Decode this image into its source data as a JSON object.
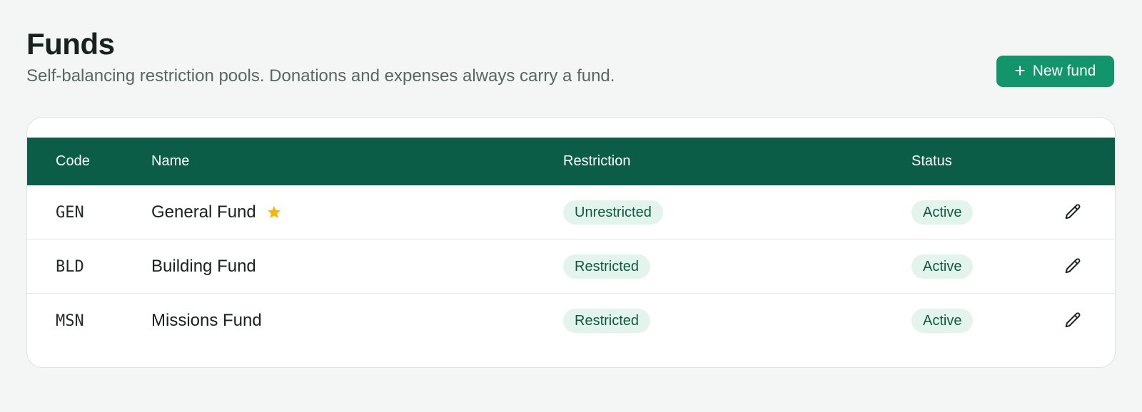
{
  "header": {
    "title": "Funds",
    "subtitle": "Self-balancing restriction pools. Donations and expenses always carry a fund.",
    "new_button_label": "New fund",
    "new_button_icon": "plus-icon"
  },
  "colors": {
    "primary_button": "#12956a",
    "table_header": "#0b5d47",
    "badge_bg": "#e3f4ec",
    "badge_text": "#0d5a43",
    "star": "#f5b50a"
  },
  "table": {
    "columns": [
      "Code",
      "Name",
      "Restriction",
      "Status"
    ],
    "rows": [
      {
        "code": "GEN",
        "name": "General Fund",
        "default": true,
        "default_icon": "star-icon",
        "restriction": "Unrestricted",
        "status": "Active",
        "action_icon": "pencil-icon"
      },
      {
        "code": "BLD",
        "name": "Building Fund",
        "default": false,
        "restriction": "Restricted",
        "status": "Active",
        "action_icon": "pencil-icon"
      },
      {
        "code": "MSN",
        "name": "Missions Fund",
        "default": false,
        "restriction": "Restricted",
        "status": "Active",
        "action_icon": "pencil-icon"
      }
    ]
  }
}
